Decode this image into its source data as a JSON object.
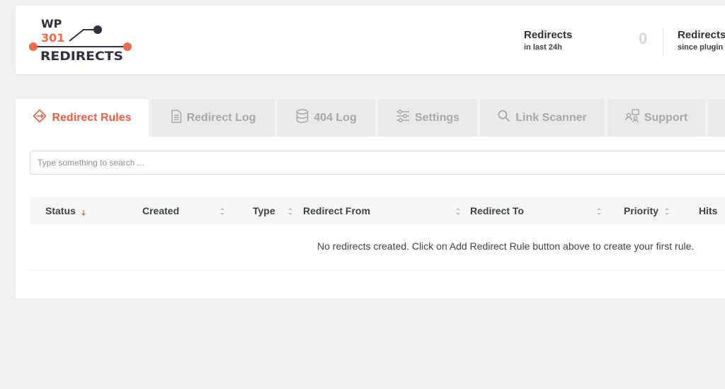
{
  "logo": {
    "line1": "WP",
    "line2": "301",
    "line3": "REDIRECTS",
    "colors": {
      "accent": "#ef6a4a",
      "dark": "#2f3140"
    }
  },
  "stats": [
    {
      "title": "Redirects",
      "subtitle": "in last 24h",
      "value": "0"
    },
    {
      "title": "Redirects",
      "subtitle": "since plugin"
    }
  ],
  "tabs": [
    {
      "label": "Redirect Rules",
      "icon": "redirect-arrows-icon",
      "active": true
    },
    {
      "label": "Redirect Log",
      "icon": "document-icon"
    },
    {
      "label": "404 Log",
      "icon": "database-icon"
    },
    {
      "label": "Settings",
      "icon": "sliders-icon"
    },
    {
      "label": "Link Scanner",
      "icon": "search-icon"
    },
    {
      "label": "Support",
      "icon": "support-icon"
    }
  ],
  "search": {
    "placeholder": "Type something to search ..."
  },
  "table": {
    "columns": [
      "Status",
      "Created",
      "Type",
      "Redirect From",
      "Redirect To",
      "Priority",
      "Hits"
    ],
    "sorted_column": "Status",
    "empty_message": "No redirects created. Click on Add Redirect Rule button above to create your first rule."
  },
  "colors": {
    "accent": "#e5604a",
    "background": "#f1f1f1",
    "tab_inactive": "#e9e9e9"
  }
}
